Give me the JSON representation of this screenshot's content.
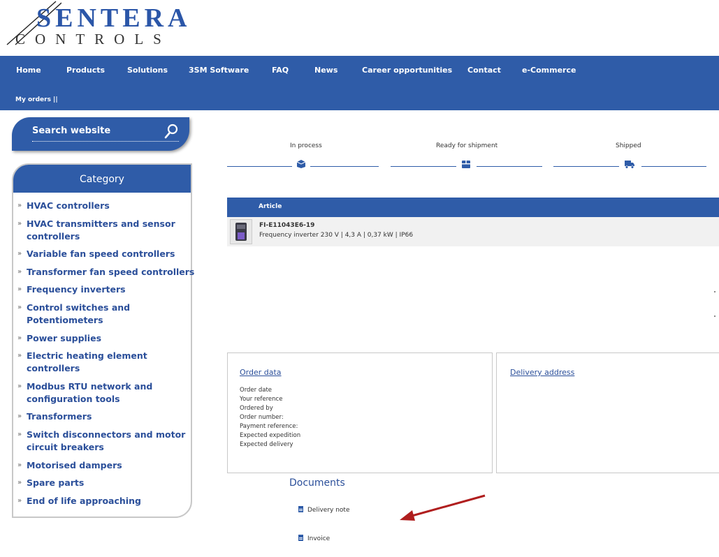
{
  "logo": {
    "line1": "SENTERA",
    "line2": "CONTROLS"
  },
  "nav": {
    "items": [
      "Home",
      "Products",
      "Solutions",
      "3SM Software",
      "FAQ",
      "News",
      "Career opportunities",
      "Contact",
      "e-Commerce"
    ],
    "sub": "My orders  ||"
  },
  "search": {
    "label": "Search website",
    "icon": "search-icon"
  },
  "category": {
    "title": "Category",
    "items": [
      "HVAC controllers",
      "HVAC transmitters and sensor controllers",
      "Variable fan speed controllers",
      "Transformer fan speed controllers",
      "Frequency inverters",
      "Control switches and Potentiometers",
      "Power supplies",
      "Electric heating element controllers",
      "Modbus RTU network and configuration tools",
      "Transformers",
      "Switch disconnectors and motor circuit breakers",
      "Motorised dampers",
      "Spare parts",
      "End of life approaching"
    ]
  },
  "status": {
    "steps": [
      {
        "label": "In process",
        "icon": "box-icon"
      },
      {
        "label": "Ready for shipment",
        "icon": "package-icon"
      },
      {
        "label": "Shipped",
        "icon": "truck-icon"
      }
    ]
  },
  "article": {
    "header": "Article",
    "code": "FI-E11043E6-19",
    "description": "Frequency inverter 230 V | 4,3 A | 0,37 kW | IP66"
  },
  "order_data": {
    "title": "Order data",
    "fields": [
      "Order date",
      "Your reference",
      "Ordered by",
      "Order number:",
      "Payment reference:",
      "Expected expedition",
      "Expected delivery"
    ]
  },
  "delivery": {
    "title": "Delivery address"
  },
  "documents": {
    "title": "Documents",
    "items": [
      "Delivery note",
      "Invoice"
    ]
  },
  "colors": {
    "brand_blue": "#2f5ca8",
    "arrow_red": "#b01e1e"
  }
}
